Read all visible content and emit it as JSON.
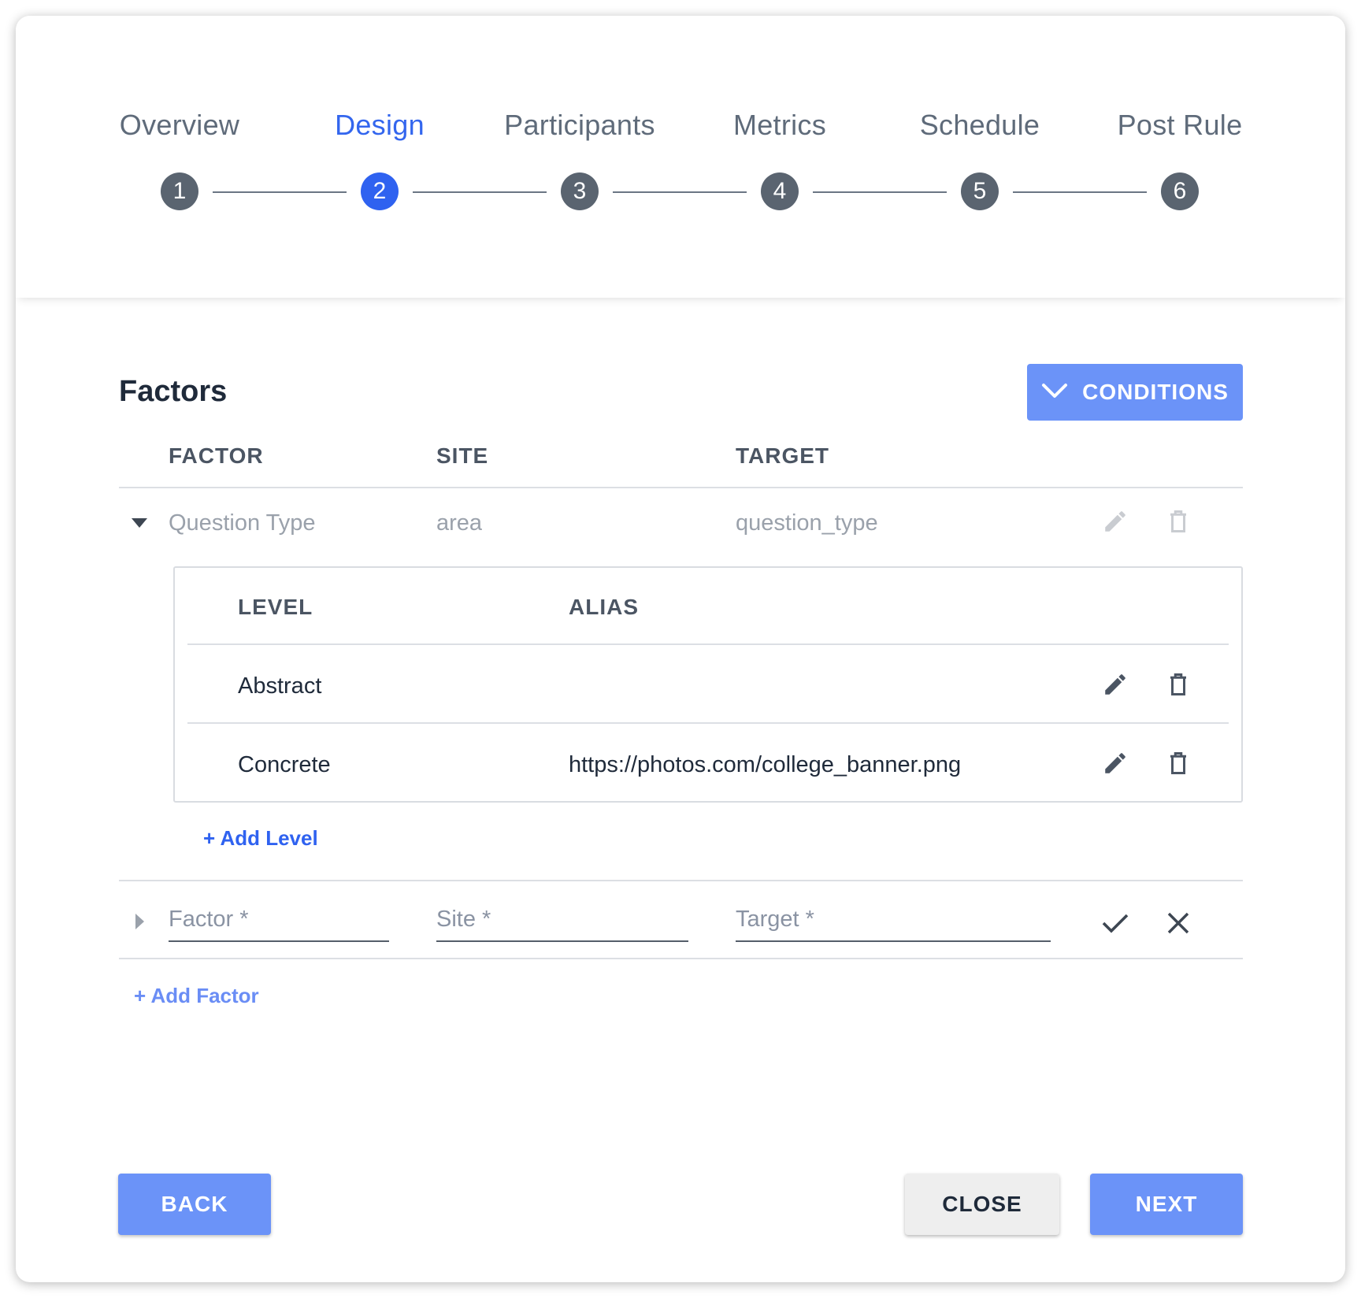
{
  "stepper": {
    "steps": [
      {
        "label": "Overview",
        "number": "1",
        "active": false
      },
      {
        "label": "Design",
        "number": "2",
        "active": true
      },
      {
        "label": "Participants",
        "number": "3",
        "active": false
      },
      {
        "label": "Metrics",
        "number": "4",
        "active": false
      },
      {
        "label": "Schedule",
        "number": "5",
        "active": false
      },
      {
        "label": "Post Rule",
        "number": "6",
        "active": false
      }
    ]
  },
  "factors": {
    "title": "Factors",
    "conditions_button": "CONDITIONS",
    "columns": {
      "factor": "FACTOR",
      "site": "SITE",
      "target": "TARGET"
    },
    "rows": [
      {
        "factor": "Question Type",
        "site": "area",
        "target": "question_type"
      }
    ],
    "levels": {
      "columns": {
        "level": "LEVEL",
        "alias": "ALIAS"
      },
      "rows": [
        {
          "level": "Abstract",
          "alias": ""
        },
        {
          "level": "Concrete",
          "alias": "https://photos.com/college_banner.png"
        }
      ],
      "add_level": "+ Add Level"
    },
    "new_factor": {
      "factor_placeholder": "Factor *",
      "site_placeholder": "Site *",
      "target_placeholder": "Target *"
    },
    "add_factor": "+ Add Factor"
  },
  "footer": {
    "back": "BACK",
    "close": "CLOSE",
    "next": "NEXT"
  },
  "colors": {
    "accent": "#2f62f0",
    "primary_button": "#6b93f8",
    "step_inactive": "#5a6470"
  }
}
